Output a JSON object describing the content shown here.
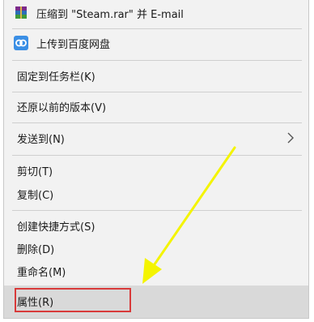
{
  "menu": {
    "items": [
      {
        "id": "compress-email",
        "label": "压缩到 \"Steam.rar\" 并 E-mail",
        "icon": "winrar-archive-icon"
      },
      {
        "id": "baidu-upload",
        "label": "上传到百度网盘",
        "icon": "baidu-netdisk-icon"
      },
      {
        "id": "pin-taskbar",
        "label": "固定到任务栏(K)"
      },
      {
        "id": "restore-prev",
        "label": "还原以前的版本(V)"
      },
      {
        "id": "send-to",
        "label": "发送到(N)",
        "icon": "chevron-right-icon"
      },
      {
        "id": "cut",
        "label": "剪切(T)"
      },
      {
        "id": "copy",
        "label": "复制(C)"
      },
      {
        "id": "create-shortcut",
        "label": "创建快捷方式(S)"
      },
      {
        "id": "delete",
        "label": "删除(D)"
      },
      {
        "id": "rename",
        "label": "重命名(M)"
      },
      {
        "id": "properties",
        "label": "属性(R)"
      }
    ]
  },
  "colors": {
    "menu_bg": "#f2f2f2",
    "highlight_row": "#d9d9d9",
    "highlight_border": "#d83a3a",
    "arrow": "#ffff00"
  }
}
